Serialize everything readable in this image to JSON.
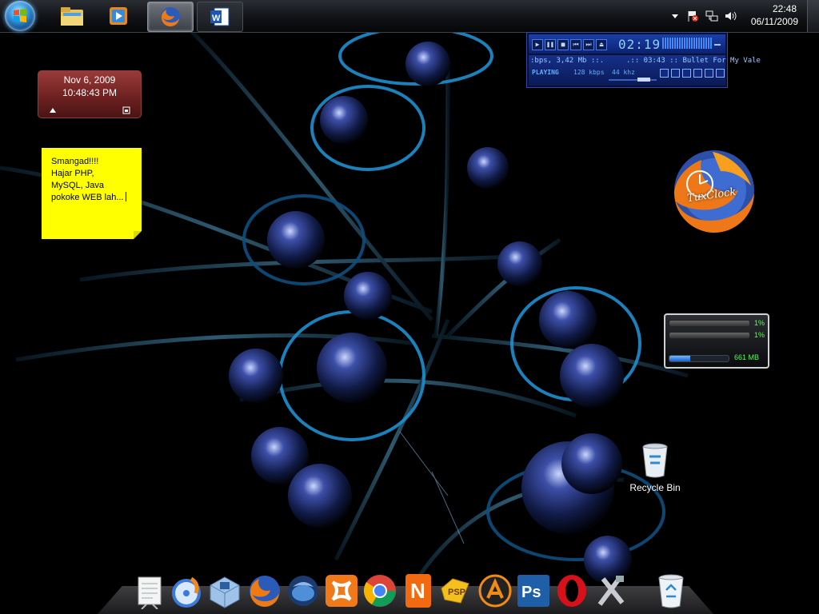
{
  "taskbar": {
    "buttons": [
      {
        "name": "windows-explorer",
        "icon": "folder-icon"
      },
      {
        "name": "media-player",
        "icon": "media-player-icon"
      },
      {
        "name": "firefox",
        "icon": "firefox-icon",
        "active": true
      },
      {
        "name": "word",
        "icon": "word-icon"
      }
    ],
    "tray": {
      "icons": [
        "expand-tray-icon",
        "flag-alert-icon",
        "network-icon",
        "volume-icon"
      ],
      "time": "22:48",
      "date": "06/11/2009"
    }
  },
  "calendar_gadget": {
    "date": "Nov 6, 2009",
    "time": "10:48:43 PM"
  },
  "sticky_note": {
    "lines": [
      "Smangad!!!!",
      "Hajar PHP,",
      "MySQL, Java",
      "pokoke WEB lah..."
    ]
  },
  "winamp": {
    "time": "02:19",
    "info_left": ":bps, 3,42 Mb ::.",
    "info_right": ".:: 03:43 :: Bullet For My Vale",
    "status": "PLAYING",
    "kbps": "128 kbps",
    "khz": "44 khz"
  },
  "tuxclock": {
    "label": "TuxClock"
  },
  "resource_meter": {
    "cpu1": "1%",
    "cpu2": "1%",
    "ram": "661 MB"
  },
  "desktop": {
    "recycle_bin_label": "Recycle Bin"
  },
  "dock": {
    "items": [
      "notepad-icon",
      "disc-burner-icon",
      "virtualbox-icon",
      "firefox-icon",
      "thunderbird-icon",
      "xampp-icon",
      "chrome-icon",
      "nero-icon",
      "psp-icon",
      "avast-icon",
      "photoshop-icon",
      "opera-icon",
      "tools-icon",
      "recycle-bin-icon"
    ]
  },
  "colors": {
    "accent_blue": "#1e90ff",
    "sticky_yellow": "#ffff00",
    "calendar_red": "#8a2b2b"
  }
}
